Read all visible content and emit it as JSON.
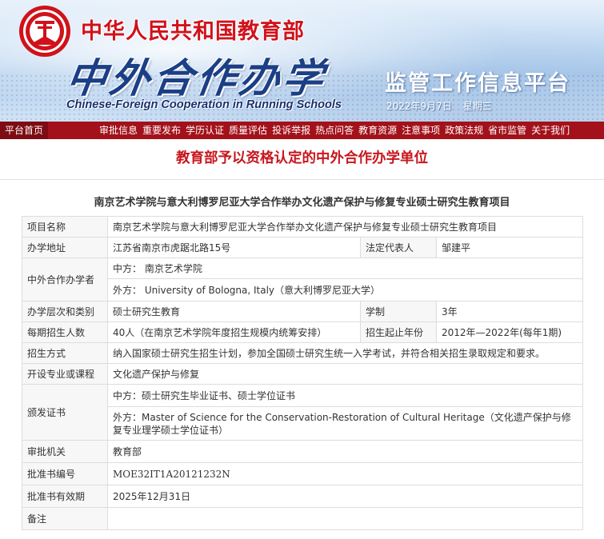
{
  "header": {
    "ministry": "中华人民共和国教育部",
    "brand_cn": "中外合作办学",
    "brand_en": "Chinese-Foreign Cooperation in Running Schools",
    "platform": "监管工作信息平台",
    "date": "2022年9月7日",
    "weekday": "星期三"
  },
  "nav": {
    "home": "平台首页",
    "items": [
      "审批信息",
      "重要发布",
      "学历认证",
      "质量评估",
      "投诉举报",
      "热点问答",
      "教育资源",
      "注意事项",
      "政策法规",
      "省市监管",
      "关于我们"
    ]
  },
  "page_title": "教育部予以资格认定的中外合作办学单位",
  "project_title": "南京艺术学院与意大利博罗尼亚大学合作举办文化遗产保护与修复专业硕士研究生教育项目",
  "table": {
    "project_name_label": "项目名称",
    "project_name": "南京艺术学院与意大利博罗尼亚大学合作举办文化遗产保护与修复专业硕士研究生教育项目",
    "address_label": "办学地址",
    "address": "江苏省南京市虎踞北路15号",
    "legal_rep_label": "法定代表人",
    "legal_rep": "邹建平",
    "partners_label": "中外合作办学者",
    "partner_cn": "中方：  南京艺术学院",
    "partner_foreign": "外方：  University of Bologna, Italy（意大利博罗尼亚大学）",
    "level_label": "办学层次和类别",
    "level": "硕士研究生教育",
    "duration_label": "学制",
    "duration": "3年",
    "enrollment_label": "每期招生人数",
    "enrollment": "40人（在南京艺术学院年度招生规模内统筹安排）",
    "period_label": "招生起止年份",
    "period": "2012年—2022年(每年1期)",
    "admission_label": "招生方式",
    "admission": "纳入国家硕士研究生招生计划，参加全国硕士研究生统一入学考试，并符合相关招生录取规定和要求。",
    "major_label": "开设专业或课程",
    "major": "文化遗产保护与修复",
    "cert_label": "颁发证书",
    "cert_cn": "中方：硕士研究生毕业证书、硕士学位证书",
    "cert_foreign": "外方：Master of Science for the Conservation-Restoration of Cultural Heritage（文化遗产保护与修复专业理学硕士学位证书）",
    "authority_label": "审批机关",
    "authority": "教育部",
    "approval_no_label": "批准书编号",
    "approval_no": "MOE32IT1A20121232N",
    "validity_label": "批准书有效期",
    "validity": "2025年12月31日",
    "remarks_label": "备注",
    "remarks": ""
  },
  "colors": {
    "nav_bg": "#a3111a",
    "nav_home_bg": "#7d0d13",
    "title_red": "#c8161d",
    "brand_blue": "#1b3f86"
  }
}
